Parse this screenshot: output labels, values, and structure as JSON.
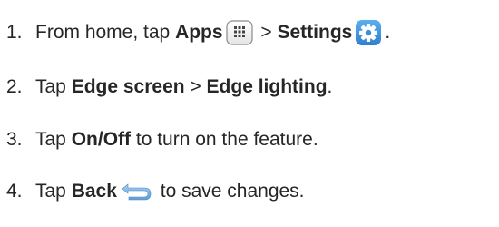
{
  "steps": [
    {
      "number": "1.",
      "parts": {
        "t1": "From home, tap ",
        "b1": "Apps",
        "icon1": "apps-grid-icon",
        "t2": " > ",
        "b2": "Settings",
        "icon2": "settings-gear-icon",
        "t3": "."
      }
    },
    {
      "number": "2.",
      "parts": {
        "t1": "Tap ",
        "b1": "Edge screen",
        "t2": " > ",
        "b2": "Edge lighting",
        "t3": "."
      }
    },
    {
      "number": "3.",
      "parts": {
        "t1": "Tap ",
        "b1": "On/Off",
        "t2": " to turn on the feature."
      }
    },
    {
      "number": "4.",
      "parts": {
        "t1": "Tap ",
        "b1": "Back",
        "icon1": "back-arrow-icon",
        "t2": " to save changes."
      }
    }
  ],
  "colors": {
    "text": "#262626",
    "settings_icon": "#3a8fd9",
    "apps_icon_border": "#8a8a8a",
    "back_icon": "#7fb5e6"
  }
}
